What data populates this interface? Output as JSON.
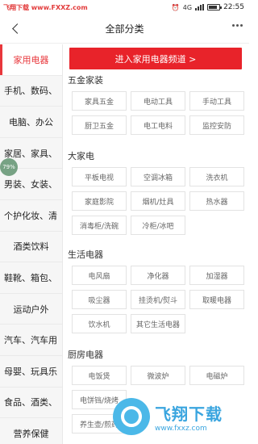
{
  "statusbar": {
    "watermark": "飞翔下载 www.FXXZ.com",
    "network": "4G",
    "time": "22:55",
    "battery_level": 0.8
  },
  "header": {
    "title": "全部分类"
  },
  "sidebar": {
    "items": [
      {
        "label": "家用电器",
        "active": true
      },
      {
        "label": "手机、数码、"
      },
      {
        "label": "电脑、办公"
      },
      {
        "label": "家居、家具、"
      },
      {
        "label": "男装、女装、"
      },
      {
        "label": "个护化妆、清"
      },
      {
        "label": "酒类饮料"
      },
      {
        "label": "鞋靴、箱包、"
      },
      {
        "label": "运动户外"
      },
      {
        "label": "汽车、汽车用"
      },
      {
        "label": "母婴、玩具乐"
      },
      {
        "label": "食品、酒类、"
      },
      {
        "label": "营养保健"
      }
    ],
    "progress_bubble": "79%"
  },
  "main": {
    "banner": "进入家用电器频道 >",
    "sections": [
      {
        "title": "五金家装",
        "items": [
          "家具五金",
          "电动工具",
          "手动工具",
          "厨卫五金",
          "电工电料",
          "监控安防"
        ]
      },
      {
        "title": "大家电",
        "items": [
          "平板电视",
          "空调冰箱",
          "洗衣机",
          "家庭影院",
          "烟机/灶具",
          "热水器",
          "消毒柜/洗碗",
          "冷柜/冰吧"
        ]
      },
      {
        "title": "生活电器",
        "items": [
          "电风扇",
          "净化器",
          "加湿器",
          "吸尘器",
          "挂烫机/熨斗",
          "取暖电器",
          "饮水机",
          "其它生活电器"
        ]
      },
      {
        "title": "厨房电器",
        "items": [
          "电饭煲",
          "微波炉",
          "电磁炉",
          "电饼铛/烧烤",
          "",
          "",
          "养生壶/煎药",
          "",
          ""
        ]
      }
    ]
  },
  "logo": {
    "cn": "飞翔下载",
    "en": "www.fxxz.com"
  },
  "colors": {
    "accent": "#e8232a",
    "sidebar_bg": "#f6f6f6",
    "logo": "#3aa5df"
  }
}
